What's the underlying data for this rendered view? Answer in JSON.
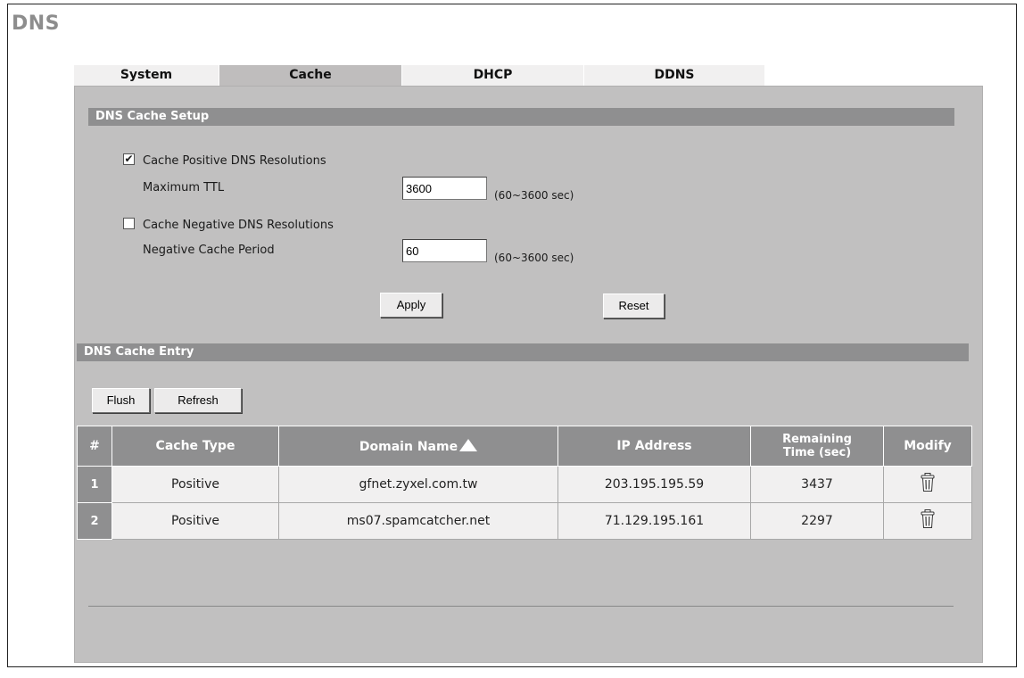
{
  "page": {
    "title": "DNS"
  },
  "tabs": [
    {
      "label": "System",
      "active": false
    },
    {
      "label": "Cache",
      "active": true
    },
    {
      "label": "DHCP",
      "active": false
    },
    {
      "label": "DDNS",
      "active": false
    }
  ],
  "cache_setup": {
    "section_title": "DNS Cache Setup",
    "positive": {
      "label": "Cache Positive DNS Resolutions",
      "checked": true
    },
    "max_ttl": {
      "label": "Maximum TTL",
      "value": "3600",
      "hint": "(60~3600 sec)"
    },
    "negative": {
      "label": "Cache Negative DNS Resolutions",
      "checked": false
    },
    "neg_period": {
      "label": "Negative Cache Period",
      "value": "60",
      "hint": "(60~3600 sec)"
    },
    "apply_label": "Apply",
    "reset_label": "Reset"
  },
  "cache_entry": {
    "section_title": "DNS Cache Entry",
    "flush_label": "Flush",
    "refresh_label": "Refresh",
    "columns": {
      "num": "#",
      "cache_type": "Cache Type",
      "domain_name": "Domain Name",
      "ip_address": "IP Address",
      "remaining_1": "Remaining",
      "remaining_2": "Time (sec)",
      "modify": "Modify"
    },
    "sorted_column": "domain_name",
    "rows": [
      {
        "num": "1",
        "cache_type": "Positive",
        "domain": "gfnet.zyxel.com.tw",
        "ip": "203.195.195.59",
        "remaining": "3437",
        "modify_icon": "trash-icon"
      },
      {
        "num": "2",
        "cache_type": "Positive",
        "domain": "ms07.spamcatcher.net",
        "ip": "71.129.195.161",
        "remaining": "2297",
        "modify_icon": "trash-icon"
      }
    ]
  },
  "colors": {
    "section_bar": "#8f8f90",
    "panel": "#c1c0c0",
    "active_tab": "#bfbdbd",
    "inactive_tab": "#f1f0f0",
    "row_bg": "#f1f0f0"
  }
}
